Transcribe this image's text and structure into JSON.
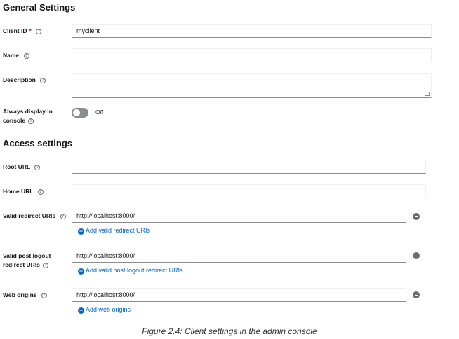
{
  "general": {
    "heading": "General Settings",
    "client_id": {
      "label": "Client ID",
      "required_mark": "*",
      "value": "myclient"
    },
    "name": {
      "label": "Name",
      "value": ""
    },
    "description": {
      "label": "Description",
      "value": ""
    },
    "always_display": {
      "label_line1": "Always display in",
      "label_line2": "console",
      "state": "Off"
    }
  },
  "access": {
    "heading": "Access settings",
    "root_url": {
      "label": "Root URL",
      "value": ""
    },
    "home_url": {
      "label": "Home URL",
      "value": ""
    },
    "valid_redirect": {
      "label": "Valid redirect URIs",
      "value": "http://localhost:8000/",
      "add_label": "Add valid redirect URIs"
    },
    "post_logout": {
      "label_line1": "Valid post logout",
      "label_line2": "redirect URIs",
      "value": "http://localhost:8000/",
      "add_label": "Add valid post logout redirect URIs"
    },
    "web_origins": {
      "label": "Web origins",
      "value": "http://localhost:8000/",
      "add_label": "Add web origins"
    }
  },
  "help_glyph": "?",
  "plus_glyph": "+",
  "caption": "Figure 2.4: Client settings in the admin console",
  "colors": {
    "link": "#0066cc",
    "required": "#c9190b",
    "toggle_off": "#8a8d90"
  }
}
